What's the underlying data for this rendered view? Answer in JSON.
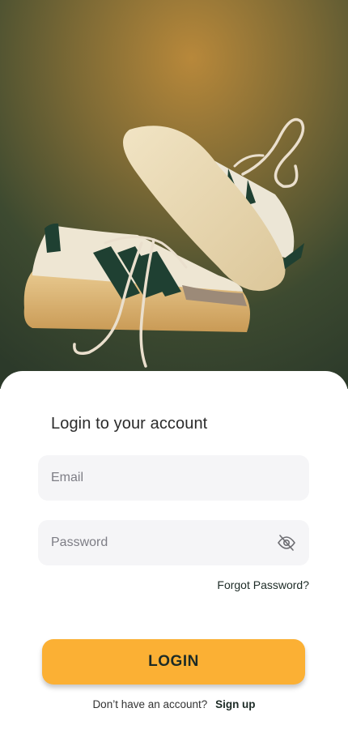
{
  "hero": {
    "image": "sneakers-photo"
  },
  "login": {
    "title": "Login to your account",
    "email_placeholder": "Email",
    "password_placeholder": "Password",
    "password_toggle_icon": "eye-off-icon",
    "forgot_label": "Forgot Password?",
    "button_label": "LOGIN",
    "signup_prompt": "Don’t have an account?",
    "signup_link": "Sign up"
  },
  "colors": {
    "accent": "#fbb034",
    "field_bg": "#f5f5f7",
    "dark_text": "#1d2b26"
  }
}
